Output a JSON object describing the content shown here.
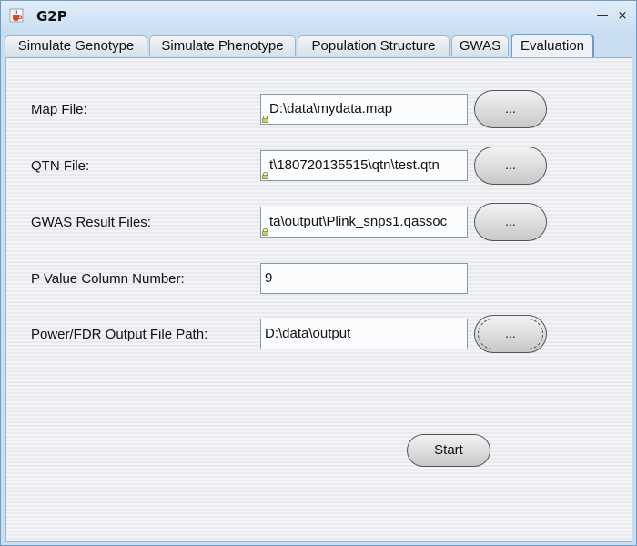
{
  "window": {
    "title": "G2P",
    "minimize_glyph": "—",
    "close_glyph": "×"
  },
  "tabs": [
    {
      "label": "Simulate Genotype",
      "active": false
    },
    {
      "label": "Simulate Phenotype",
      "active": false
    },
    {
      "label": "Population Structure",
      "active": false
    },
    {
      "label": "GWAS",
      "active": false
    },
    {
      "label": "Evaluation",
      "active": true
    }
  ],
  "form": {
    "map_file": {
      "label": "Map File:",
      "value": "D:\\data\\mydata.map",
      "button": "..."
    },
    "qtn_file": {
      "label": "QTN File:",
      "value": "t\\180720135515\\qtn\\test.qtn",
      "button": "..."
    },
    "gwas_result": {
      "label": "GWAS Result Files:",
      "value": "ta\\output\\Plink_snps1.qassoc",
      "button": "..."
    },
    "p_value_column": {
      "label": "P Value Column Number:",
      "value": "9"
    },
    "output_path": {
      "label": "Power/FDR Output File Path:",
      "value": "D:\\data\\output",
      "button": "..."
    }
  },
  "actions": {
    "start_label": "Start"
  },
  "colors": {
    "window_border": "#6f9cc6",
    "titlebar": "#c9def1",
    "panel_background": "#eef0f3",
    "button_gradient_top": "#f3f3f3",
    "button_gradient_bottom": "#c8c8c8"
  },
  "icons": {
    "app": "java-cup-icon",
    "field_lock": "lock-icon"
  }
}
